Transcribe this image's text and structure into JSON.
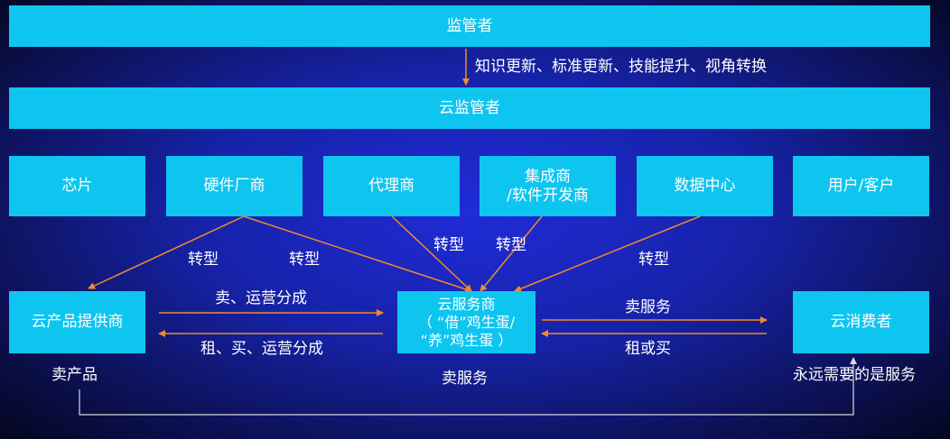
{
  "top": {
    "supervisor": "监管者",
    "transition": "知识更新、标准更新、技能提升、视角转换",
    "cloud_supervisor": "云监管者"
  },
  "players": [
    "芯片",
    "硬件厂商",
    "代理商",
    "集成商\n/软件开发商",
    "数据中心",
    "用户/客户"
  ],
  "transform_labels": [
    "转型",
    "转型",
    "转型",
    "转型",
    "转型"
  ],
  "provider": {
    "label": "云产品提供商",
    "caption": "卖产品"
  },
  "service": {
    "label": "云服务商\n（ “借”鸡生蛋/\n“养”鸡生蛋 ）",
    "caption": "卖服务"
  },
  "consumer": {
    "label": "云消费者",
    "caption": "永远需要的是服务"
  },
  "flows": {
    "provider_to_service": "卖、运营分成",
    "service_to_provider": "租、买、运营分成",
    "service_to_consumer": "卖服务",
    "consumer_to_service": "租或买"
  },
  "colors": {
    "box": "#0ec5f0",
    "arrow": "#f08a2c",
    "feedback_line": "#d8d8d8"
  }
}
